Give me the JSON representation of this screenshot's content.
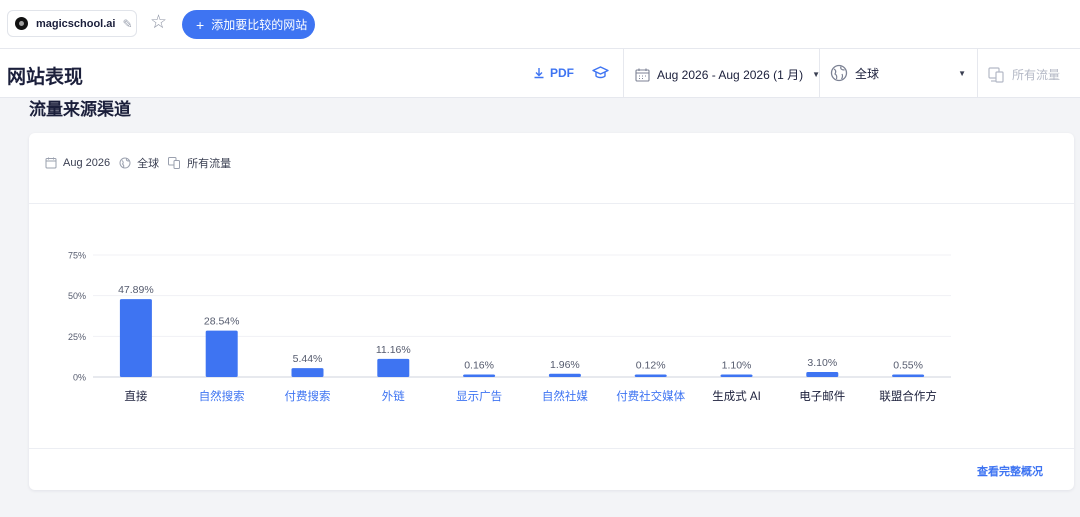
{
  "topbar": {
    "site_name": "magicschool.ai",
    "add_compare_label": "添加要比较的网站"
  },
  "header": {
    "title": "网站表现",
    "pdf_label": "PDF",
    "date_range": "Aug 2026 - Aug 2026 (1 月)",
    "region": "全球",
    "traffic_type": "所有流量"
  },
  "section": {
    "title": "流量来源渠道"
  },
  "filters": {
    "date": "Aug 2026",
    "region": "全球",
    "traffic": "所有流量"
  },
  "colors": {
    "accent": "#3e74f2",
    "bar": "#3e74f2",
    "text": "#1b1f3b"
  },
  "chart_data": {
    "type": "bar",
    "categories": [
      "直接",
      "自然搜索",
      "付费搜索",
      "外链",
      "显示广告",
      "自然社媒",
      "付费社交媒体",
      "生成式 AI",
      "电子邮件",
      "联盟合作方"
    ],
    "category_links": [
      false,
      true,
      true,
      true,
      true,
      true,
      true,
      false,
      false,
      false
    ],
    "values": [
      47.89,
      28.54,
      5.44,
      11.16,
      0.16,
      1.96,
      0.12,
      1.1,
      3.1,
      0.55
    ],
    "value_labels": [
      "47.89%",
      "28.54%",
      "5.44%",
      "11.16%",
      "0.16%",
      "1.96%",
      "0.12%",
      "1.10%",
      "3.10%",
      "0.55%"
    ],
    "yticks": [
      0,
      25,
      50,
      75
    ],
    "ytick_labels": [
      "0%",
      "25%",
      "50%",
      "75%"
    ],
    "ylim": [
      0,
      75
    ],
    "grid": true
  },
  "footer": {
    "link_label": "查看完整概况"
  }
}
